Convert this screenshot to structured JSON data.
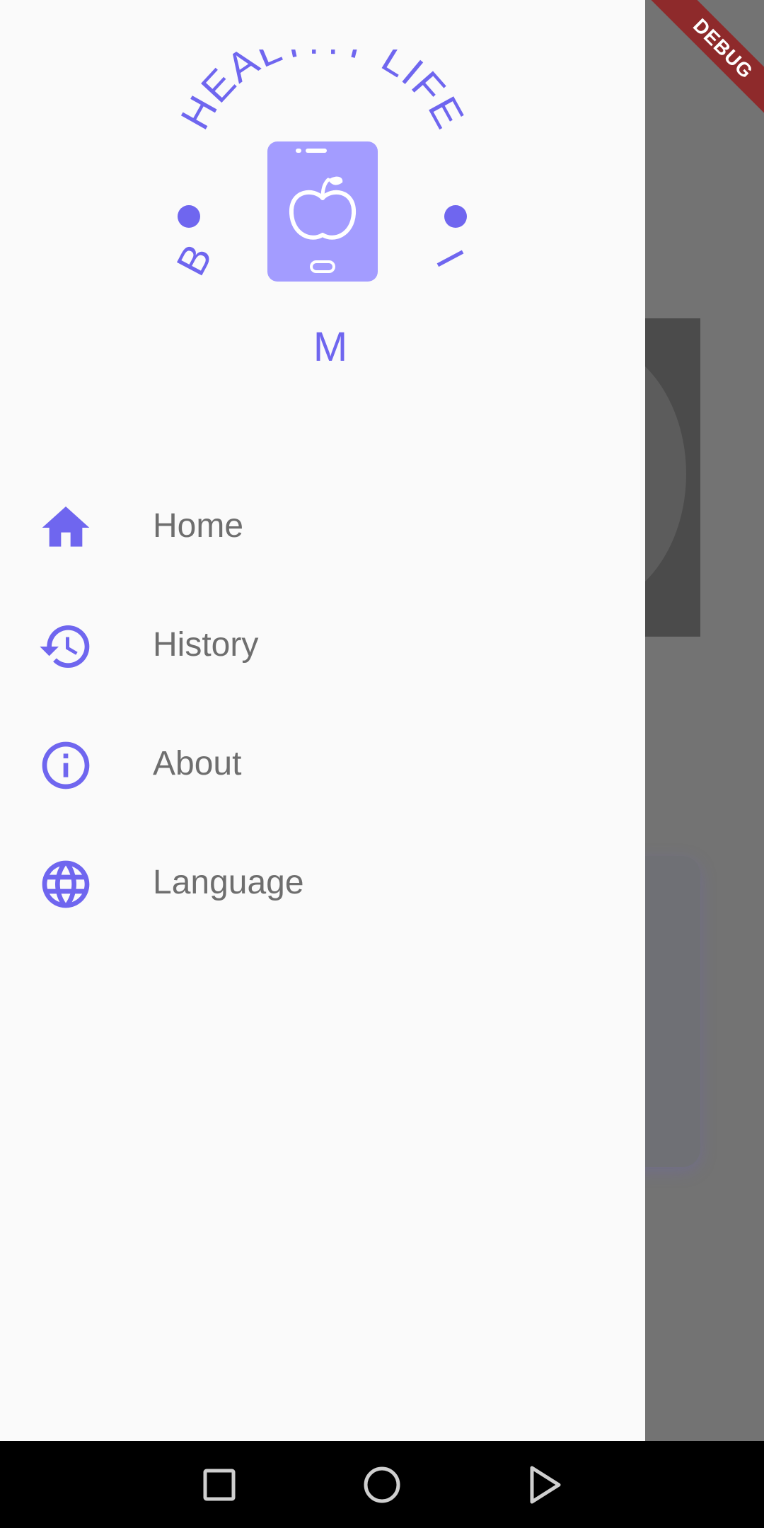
{
  "debug_banner": {
    "label": "DEBUG"
  },
  "logo": {
    "top_arc_text": "HEALTHY LIFE",
    "left_letter": "B",
    "right_letter": "I",
    "bottom_letter": "M",
    "icon_name": "phone-apple-icon",
    "accent_color": "#6f66ef",
    "phone_color": "#a39cff"
  },
  "menu": {
    "items": [
      {
        "label": "Home",
        "icon": "home-icon"
      },
      {
        "label": "History",
        "icon": "history-icon"
      },
      {
        "label": "About",
        "icon": "info-icon"
      },
      {
        "label": "Language",
        "icon": "globe-icon"
      }
    ],
    "icon_color": "#6f66ef",
    "label_color": "#6e6e6e"
  },
  "navbar": {
    "buttons": [
      {
        "icon": "recents-square-icon"
      },
      {
        "icon": "home-circle-icon"
      },
      {
        "icon": "back-triangle-icon"
      }
    ]
  }
}
